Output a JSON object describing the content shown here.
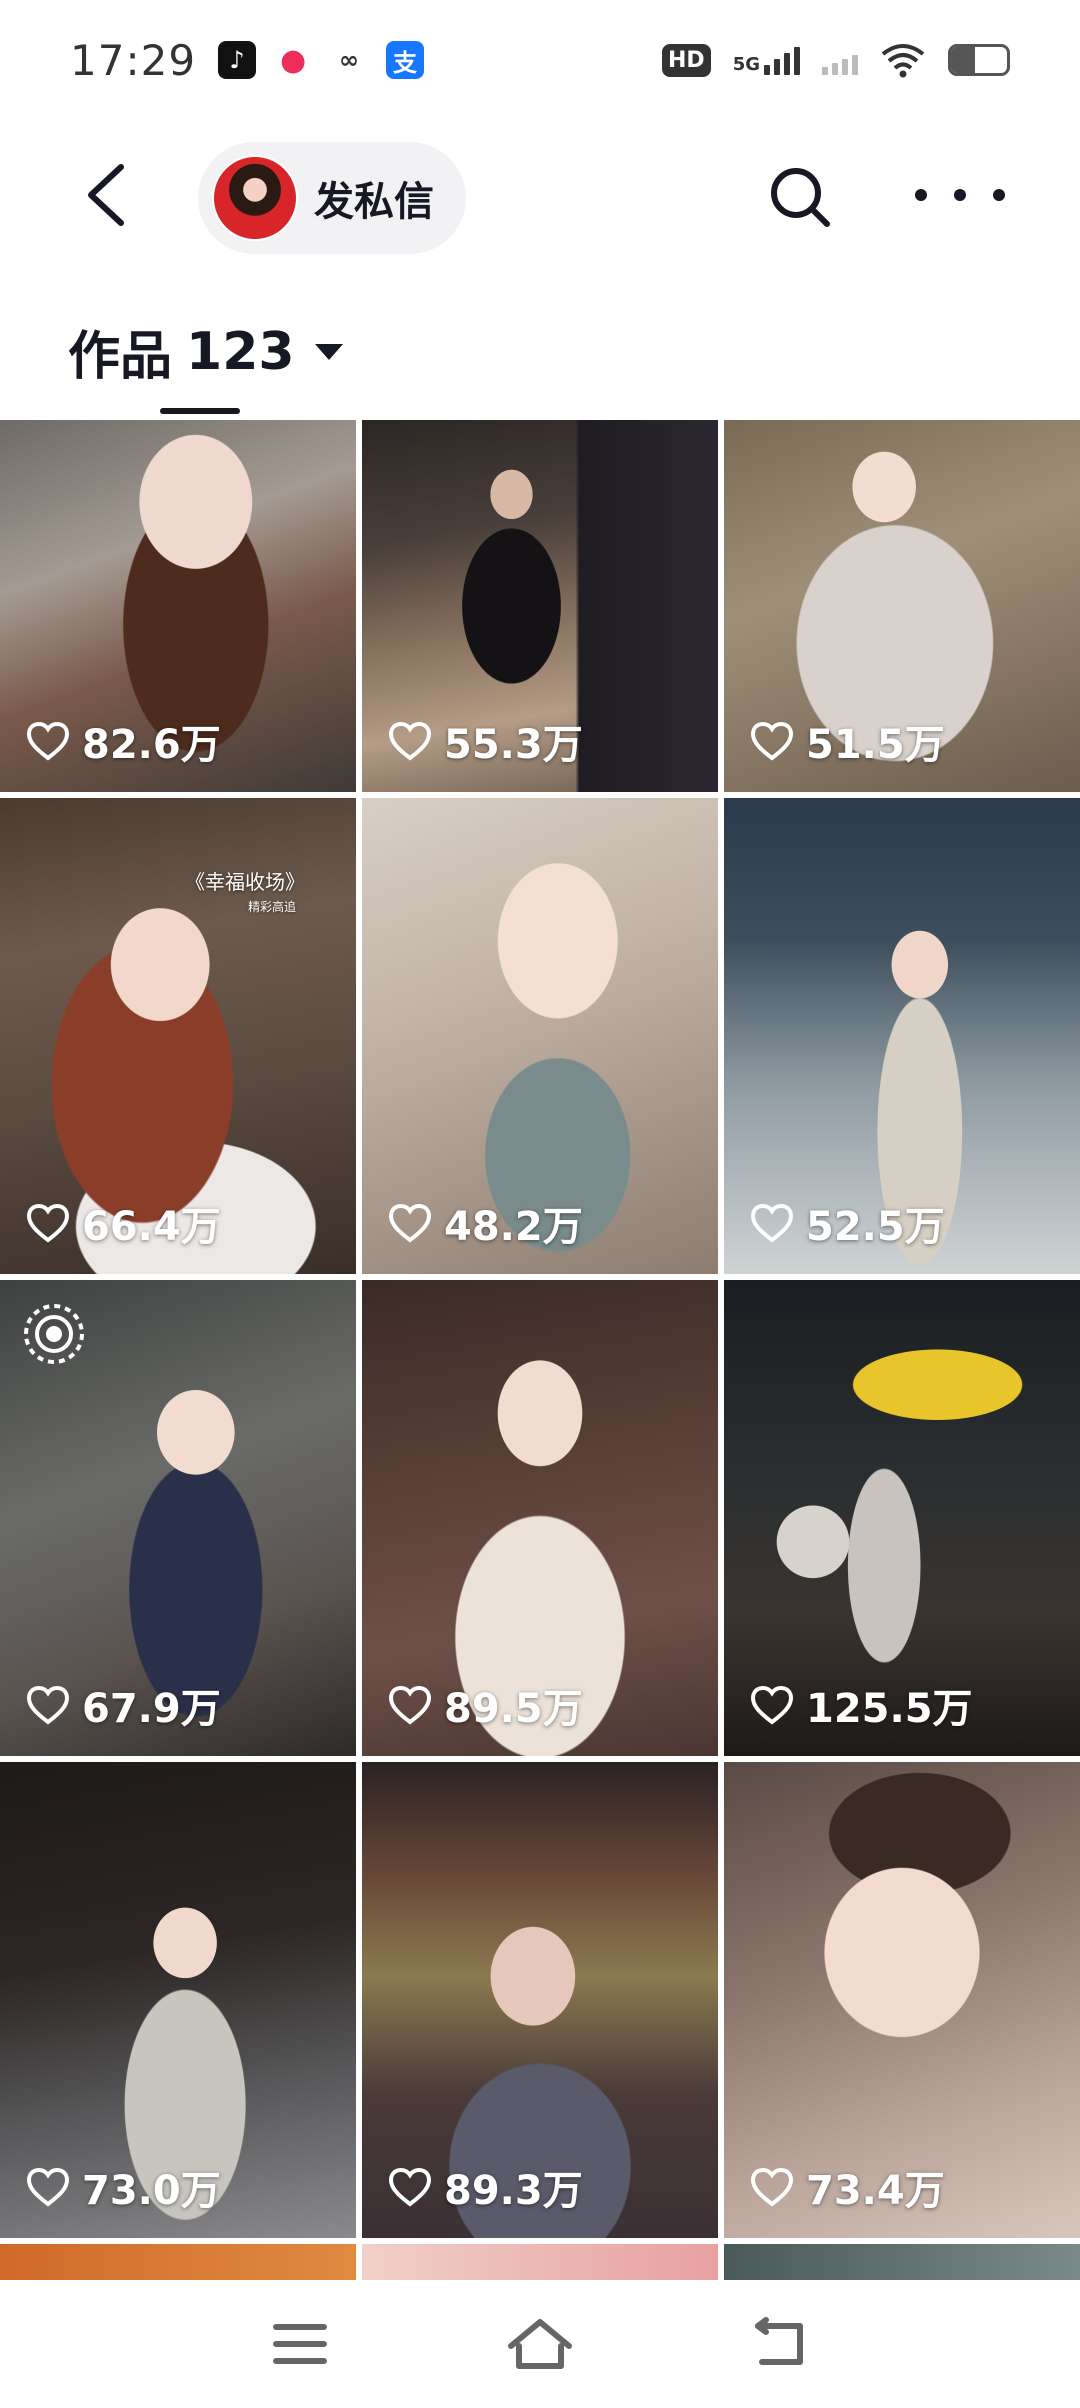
{
  "status_bar": {
    "time": "17:29",
    "hd_label": "HD",
    "network": "5G",
    "apps": [
      "tiktok-icon",
      "video-icon",
      "link-icon",
      "alipay-icon"
    ]
  },
  "header": {
    "dm_label": "发私信",
    "back_icon": "chevron-left-icon",
    "search_icon": "search-icon",
    "more_icon": "more-dots-icon"
  },
  "tab": {
    "label": "作品",
    "count": "123"
  },
  "posts": [
    {
      "likes": "82.6万"
    },
    {
      "likes": "55.3万"
    },
    {
      "likes": "51.5万"
    },
    {
      "likes": "66.4万",
      "overlay_title": "《幸福收场》",
      "overlay_sub": "精彩高追"
    },
    {
      "likes": "48.2万"
    },
    {
      "likes": "52.5万"
    },
    {
      "likes": "67.9万"
    },
    {
      "likes": "89.5万"
    },
    {
      "likes": "125.5万"
    },
    {
      "likes": "73.0万"
    },
    {
      "likes": "89.3万"
    },
    {
      "likes": "73.4万"
    }
  ],
  "bottom_nav": [
    "menu-icon",
    "home-icon",
    "back-icon"
  ]
}
